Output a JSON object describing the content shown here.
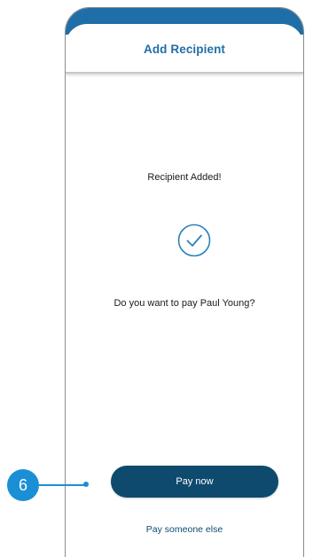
{
  "header": {
    "title": "Add Recipient"
  },
  "main": {
    "status_text": "Recipient Added!",
    "question_text": "Do you want to pay Paul Young?",
    "status_icon": "check-circle-icon"
  },
  "actions": {
    "pay_now_label": "Pay now",
    "pay_someone_else_label": "Pay someone else"
  },
  "callout": {
    "number": "6"
  },
  "colors": {
    "brand_blue": "#1f6ea8",
    "button_navy": "#0d4a6e",
    "callout_blue": "#1b8fd6",
    "check_teal": "#2a83b8"
  }
}
